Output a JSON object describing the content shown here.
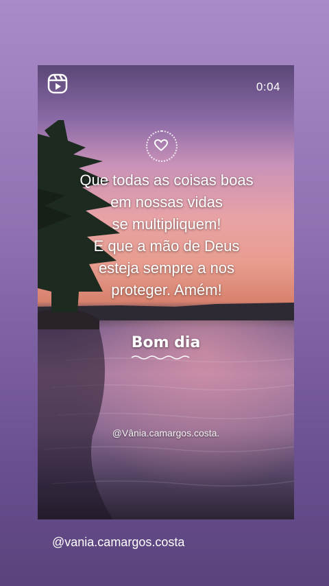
{
  "story": {
    "timer": "0:04",
    "quote_lines": [
      "Que todas as coisas boas",
      "em nossas vidas",
      "se multipliquem!",
      "E que a mão de Deus",
      "esteja sempre a nos",
      "proteger. Amém!"
    ],
    "greeting": "Bom dia",
    "watermark": "@Vânia.camargos.costa."
  },
  "footer": {
    "username": "@vania.camargos.costa"
  },
  "icons": {
    "reels": "reels-icon",
    "heart": "heart-icon"
  }
}
